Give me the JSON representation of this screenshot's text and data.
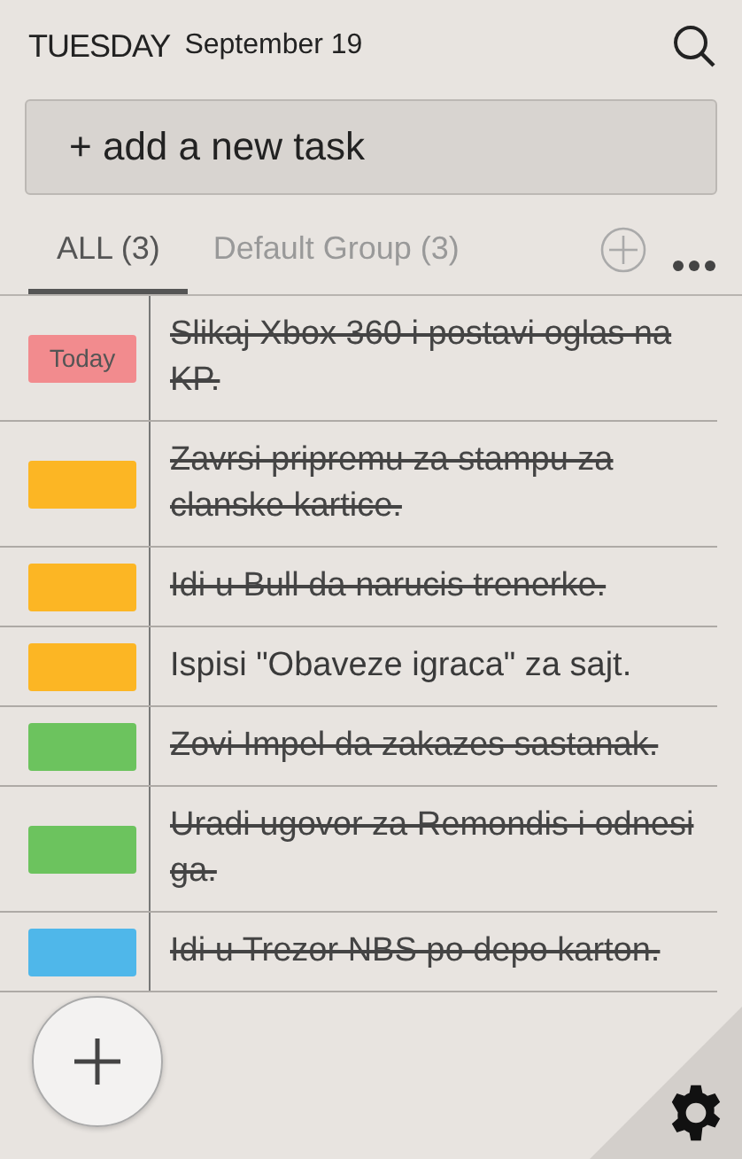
{
  "header": {
    "day": "TUESDAY",
    "date": "September 19"
  },
  "add_task": {
    "label": "+ add a new task"
  },
  "tabs": [
    {
      "label": "ALL (3)",
      "selected": true
    },
    {
      "label": "Default Group (3)",
      "selected": false
    }
  ],
  "tasks": [
    {
      "tag": "Today",
      "color": "#f28b8e",
      "text": "Slikaj Xbox 360 i postavi oglas na KP.",
      "done": true
    },
    {
      "color": "#fcb624",
      "text": "Zavrsi pripremu za stampu za clanske kartice.",
      "done": true
    },
    {
      "color": "#fcb624",
      "text": "Idi u Bull da narucis trenerke.",
      "done": true
    },
    {
      "color": "#fcb624",
      "text": "Ispisi \"Obaveze igraca\" za sajt.",
      "done": false
    },
    {
      "color": "#6cc35e",
      "text": "Zovi Impel da zakazes sastanak.",
      "done": true
    },
    {
      "color": "#6cc35e",
      "text": "Uradi ugovor za Remondis i odnesi ga.",
      "done": true
    },
    {
      "color": "#4fb7ea",
      "text": "Idi u Trezor NBS po depo karton.",
      "done": true
    }
  ]
}
